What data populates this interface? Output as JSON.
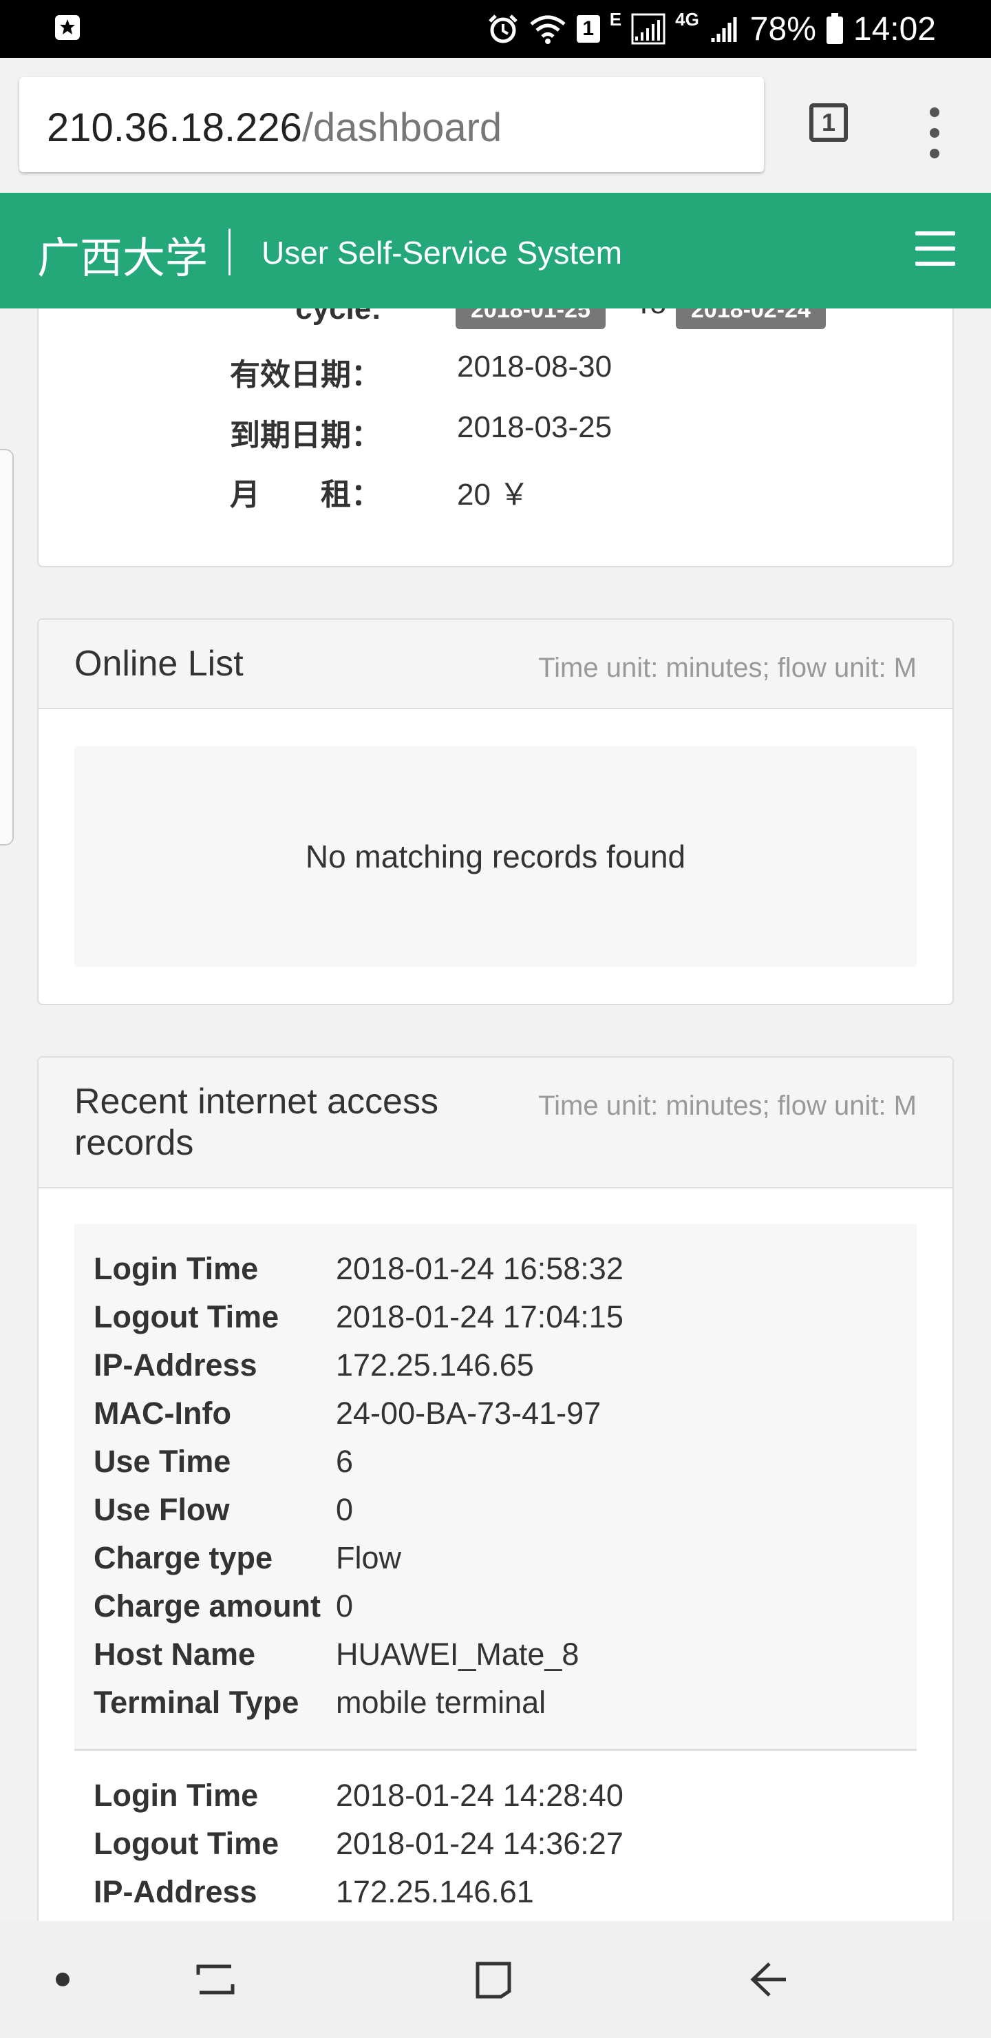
{
  "status_bar": {
    "battery": "78%",
    "time": "14:02",
    "network_e": "E",
    "network_4g": "4G",
    "notification_count": "1",
    "icons": [
      "notification-icon",
      "alarm-icon",
      "wifi-icon",
      "signal-icon",
      "battery-icon"
    ]
  },
  "browser": {
    "url_host": "210.36.18.226",
    "url_path": "/dashboard",
    "tab_count": "1"
  },
  "site": {
    "brand_cn": "广西大学",
    "brand_sub": "User Self-Service System",
    "accent_color": "#24a87a"
  },
  "account_info": {
    "cycle_label": "cycle:",
    "cycle_start": "2018-01-25",
    "cycle_to": "To",
    "cycle_end": "2018-02-24",
    "rows": [
      {
        "label": "有效日期：",
        "value": "2018-08-30"
      },
      {
        "label": "到期日期：",
        "value": "2018-03-25"
      },
      {
        "label": "月　　租：",
        "value": "20 ￥"
      }
    ]
  },
  "online_list": {
    "title": "Online List",
    "note": "Time unit: minutes; flow unit: M",
    "empty_message": "No matching records found"
  },
  "recent_records": {
    "title": "Recent internet access records",
    "note": "Time unit: minutes; flow unit: M",
    "records": [
      {
        "rows": [
          {
            "label": "Login Time",
            "value": "2018-01-24 16:58:32"
          },
          {
            "label": "Logout Time",
            "value": "2018-01-24 17:04:15"
          },
          {
            "label": "IP-Address",
            "value": "172.25.146.65"
          },
          {
            "label": "MAC-Info",
            "value": "24-00-BA-73-41-97"
          },
          {
            "label": "Use Time",
            "value": "6"
          },
          {
            "label": "Use Flow",
            "value": "0"
          },
          {
            "label": "Charge type",
            "value": "Flow"
          },
          {
            "label": "Charge amount",
            "value": "0"
          },
          {
            "label": "Host Name",
            "value": "HUAWEI_Mate_8"
          },
          {
            "label": "Terminal Type",
            "value": "mobile terminal"
          }
        ]
      },
      {
        "rows": [
          {
            "label": "Login Time",
            "value": "2018-01-24 14:28:40"
          },
          {
            "label": "Logout Time",
            "value": "2018-01-24 14:36:27"
          },
          {
            "label": "IP-Address",
            "value": "172.25.146.61"
          }
        ]
      }
    ]
  },
  "nav_bar": {
    "buttons": [
      "dot-icon",
      "recent-apps-icon",
      "home-icon",
      "back-icon"
    ]
  }
}
